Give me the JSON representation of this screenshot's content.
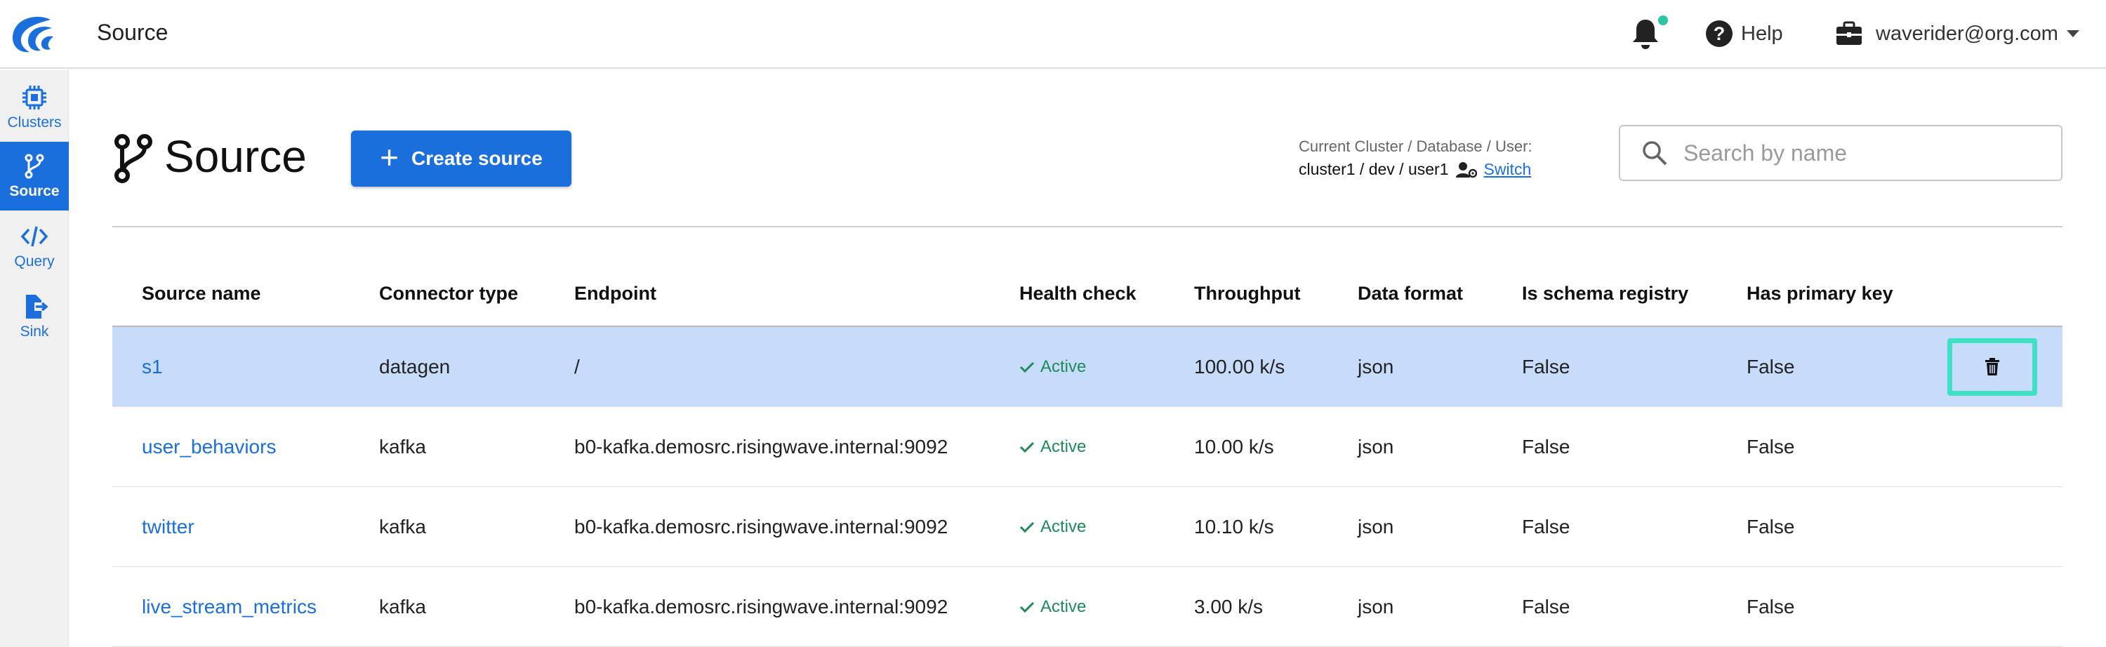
{
  "header": {
    "app_title": "Source",
    "help_label": "Help",
    "user_email": "waverider@org.com"
  },
  "sidebar": {
    "items": [
      {
        "label": "Clusters",
        "icon": "chip-icon"
      },
      {
        "label": "Source",
        "icon": "source-branch-icon",
        "active": true
      },
      {
        "label": "Query",
        "icon": "code-icon"
      },
      {
        "label": "Sink",
        "icon": "sink-export-icon"
      }
    ]
  },
  "page": {
    "title": "Source",
    "create_button": "Create source",
    "context_label": "Current Cluster / Database / User:",
    "context_value": "cluster1 / dev / user1",
    "switch_label": "Switch",
    "search_placeholder": "Search by name"
  },
  "table": {
    "columns": [
      "Source name",
      "Connector type",
      "Endpoint",
      "Health check",
      "Throughput",
      "Data format",
      "Is schema registry",
      "Has primary key"
    ],
    "rows": [
      {
        "name": "s1",
        "connector": "datagen",
        "endpoint": "/",
        "health": "Active",
        "throughput": "100.00 k/s",
        "format": "json",
        "schema_registry": "False",
        "primary_key": "False",
        "selected": true
      },
      {
        "name": "user_behaviors",
        "connector": "kafka",
        "endpoint": "b0-kafka.demosrc.risingwave.internal:9092",
        "health": "Active",
        "throughput": "10.00 k/s",
        "format": "json",
        "schema_registry": "False",
        "primary_key": "False"
      },
      {
        "name": "twitter",
        "connector": "kafka",
        "endpoint": "b0-kafka.demosrc.risingwave.internal:9092",
        "health": "Active",
        "throughput": "10.10 k/s",
        "format": "json",
        "schema_registry": "False",
        "primary_key": "False"
      },
      {
        "name": "live_stream_metrics",
        "connector": "kafka",
        "endpoint": "b0-kafka.demosrc.risingwave.internal:9092",
        "health": "Active",
        "throughput": "3.00 k/s",
        "format": "json",
        "schema_registry": "False",
        "primary_key": "False"
      }
    ]
  },
  "colors": {
    "accent": "#1a6fdd",
    "selected_row": "#c7dcfb",
    "health_active": "#1e8a5a",
    "focus_outline": "#3fe0c4",
    "notification_dot": "#2ec4a6"
  }
}
